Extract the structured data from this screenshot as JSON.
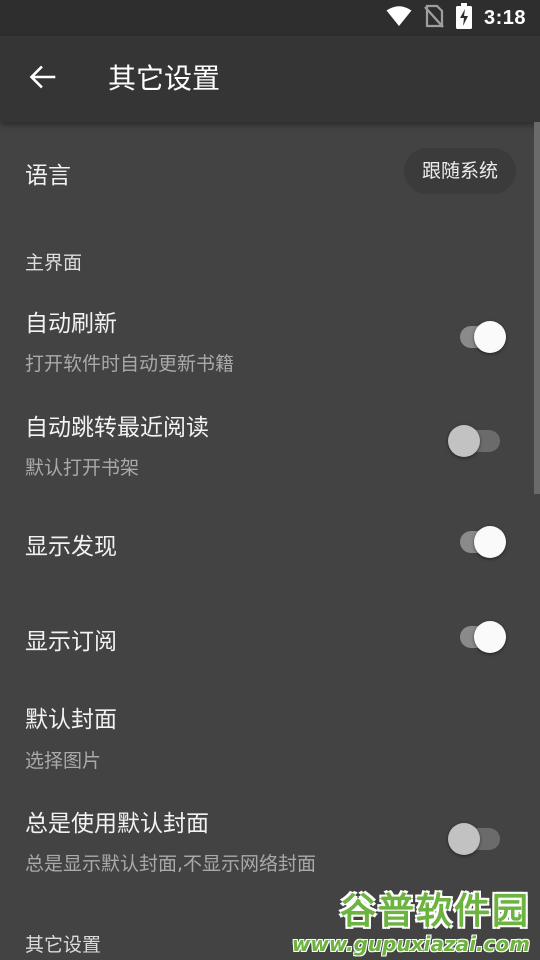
{
  "status_bar": {
    "time": "3:18",
    "icons": [
      "wifi-icon",
      "no-sim-icon",
      "battery-charging-icon"
    ]
  },
  "app_bar": {
    "back_icon": "arrow-back-icon",
    "title": "其它设置"
  },
  "settings": {
    "language": {
      "title": "语言",
      "value": "跟随系统"
    },
    "category_main": "主界面",
    "auto_refresh": {
      "title": "自动刷新",
      "summary": "打开软件时自动更新书籍",
      "enabled": true
    },
    "auto_jump_recent": {
      "title": "自动跳转最近阅读",
      "summary": "默认打开书架",
      "enabled": false
    },
    "show_discovery": {
      "title": "显示发现",
      "enabled": true
    },
    "show_rss": {
      "title": "显示订阅",
      "enabled": true
    },
    "default_cover": {
      "title": "默认封面",
      "summary": "选择图片"
    },
    "always_default_cover": {
      "title": "总是使用默认封面",
      "summary": "总是显示默认封面,不显示网络封面",
      "enabled": false
    },
    "category_other": "其它设置"
  },
  "watermark": {
    "logo_text": "谷普软件园",
    "url": "www.gupuxiazai.com"
  },
  "colors": {
    "background": "#434343",
    "status_bar": "#2e2e2e",
    "app_bar": "#353535",
    "switch_on_thumb": "#fafafa",
    "switch_off_thumb": "#c2c2c2",
    "watermark": "#6cb33f"
  }
}
